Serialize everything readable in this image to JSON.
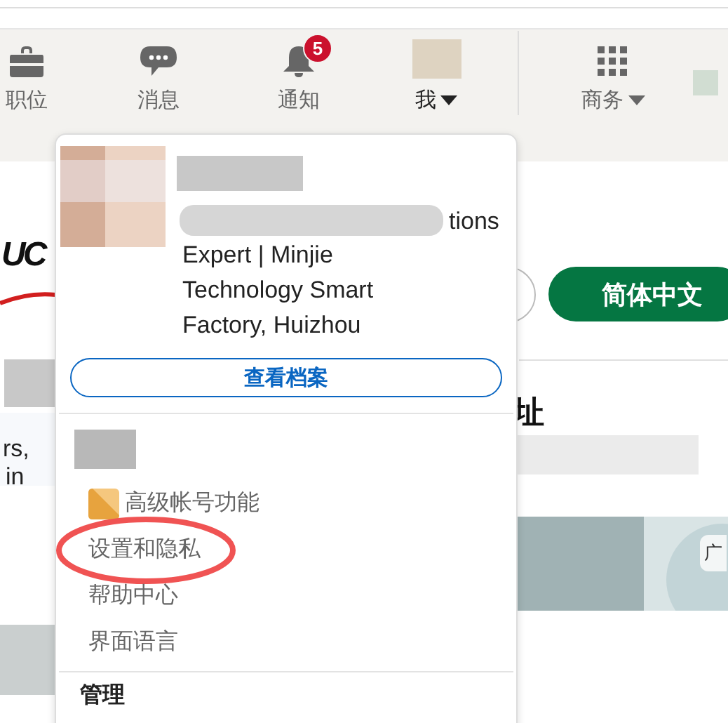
{
  "nav": {
    "items": [
      {
        "kind": "briefcase",
        "label": "职位",
        "caret": false
      },
      {
        "kind": "chat",
        "label": "消息",
        "caret": false
      },
      {
        "kind": "bell",
        "label": "通知",
        "badge": "5",
        "caret": false
      },
      {
        "label": "我",
        "caret": true
      },
      {
        "kind": "grid",
        "label": "商务",
        "caret": true
      }
    ]
  },
  "background": {
    "logo_text": "UC",
    "language_button": "简体中文",
    "heading_fragment": "址",
    "text_fragments": [
      "rs,",
      "in"
    ],
    "ad_fragment": "广"
  },
  "dropdown": {
    "headline_lines": [
      "tions",
      "Expert | Minjie",
      "Technology Smart",
      "Factory, Huizhou"
    ],
    "profile_button": "查看档案",
    "items": [
      {
        "label": "高级帐号功能",
        "kind": "premium",
        "highlighted": false
      },
      {
        "label": "设置和隐私",
        "kind": "plain",
        "highlighted": true
      },
      {
        "label": "帮助中心",
        "kind": "plain",
        "highlighted": false
      },
      {
        "label": "界面语言",
        "kind": "plain",
        "highlighted": false
      }
    ],
    "section_title": "管理"
  }
}
